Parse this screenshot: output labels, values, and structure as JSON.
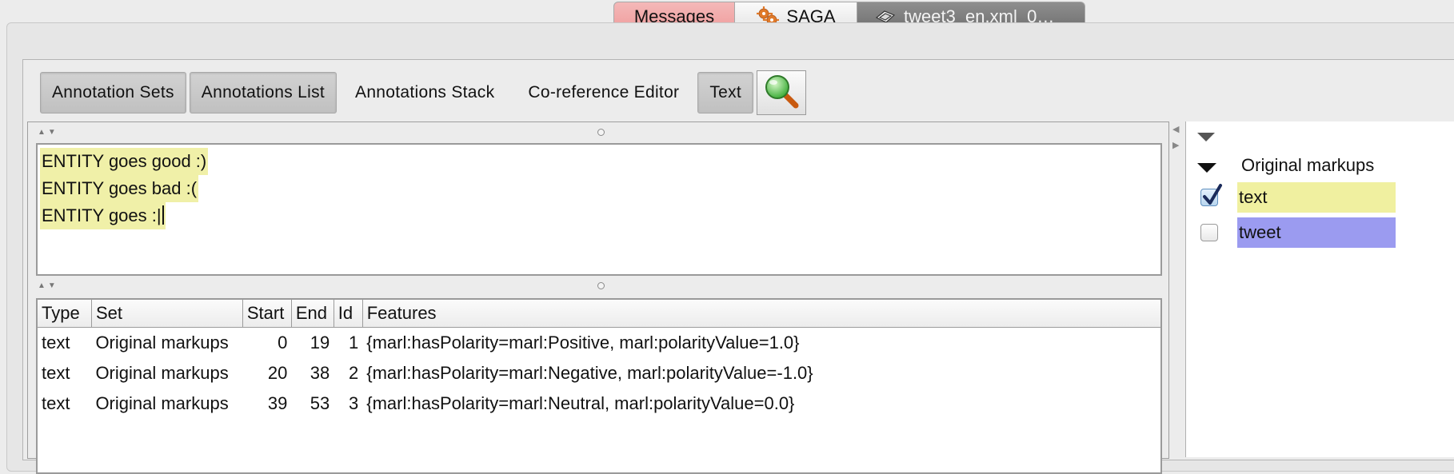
{
  "top_tabs": [
    {
      "label": "Messages"
    },
    {
      "label": "SAGA"
    },
    {
      "label": "tweet3_en.xml_0…"
    }
  ],
  "toolbar": {
    "annotation_sets": "Annotation Sets",
    "annotations_list": "Annotations List",
    "annotations_stack": "Annotations Stack",
    "coreference_editor": "Co-reference Editor",
    "text": "Text"
  },
  "document": {
    "lines": [
      "ENTITY goes good :)",
      "ENTITY goes bad :(",
      "ENTITY goes :|"
    ]
  },
  "table": {
    "headers": [
      "Type",
      "Set",
      "Start",
      "End",
      "Id",
      "Features"
    ],
    "rows": [
      [
        "text",
        "Original markups",
        "0",
        "19",
        "1",
        "{marl:hasPolarity=marl:Positive, marl:polarityValue=1.0}"
      ],
      [
        "text",
        "Original markups",
        "20",
        "38",
        "2",
        "{marl:hasPolarity=marl:Negative, marl:polarityValue=-1.0}"
      ],
      [
        "text",
        "Original markups",
        "39",
        "53",
        "3",
        "{marl:hasPolarity=marl:Neutral, marl:polarityValue=0.0}"
      ]
    ]
  },
  "annotation_sets_panel": {
    "group_label": "Original markups",
    "types": [
      {
        "label": "text",
        "checked": true,
        "color": "#f0f0a0"
      },
      {
        "label": "tweet",
        "checked": false,
        "color": "#9b9bf0"
      }
    ]
  },
  "colors": {
    "messages_tab": "#f2a9a9",
    "highlight_text": "#f0f0a8",
    "highlight_tweet": "#9b9bf0"
  }
}
